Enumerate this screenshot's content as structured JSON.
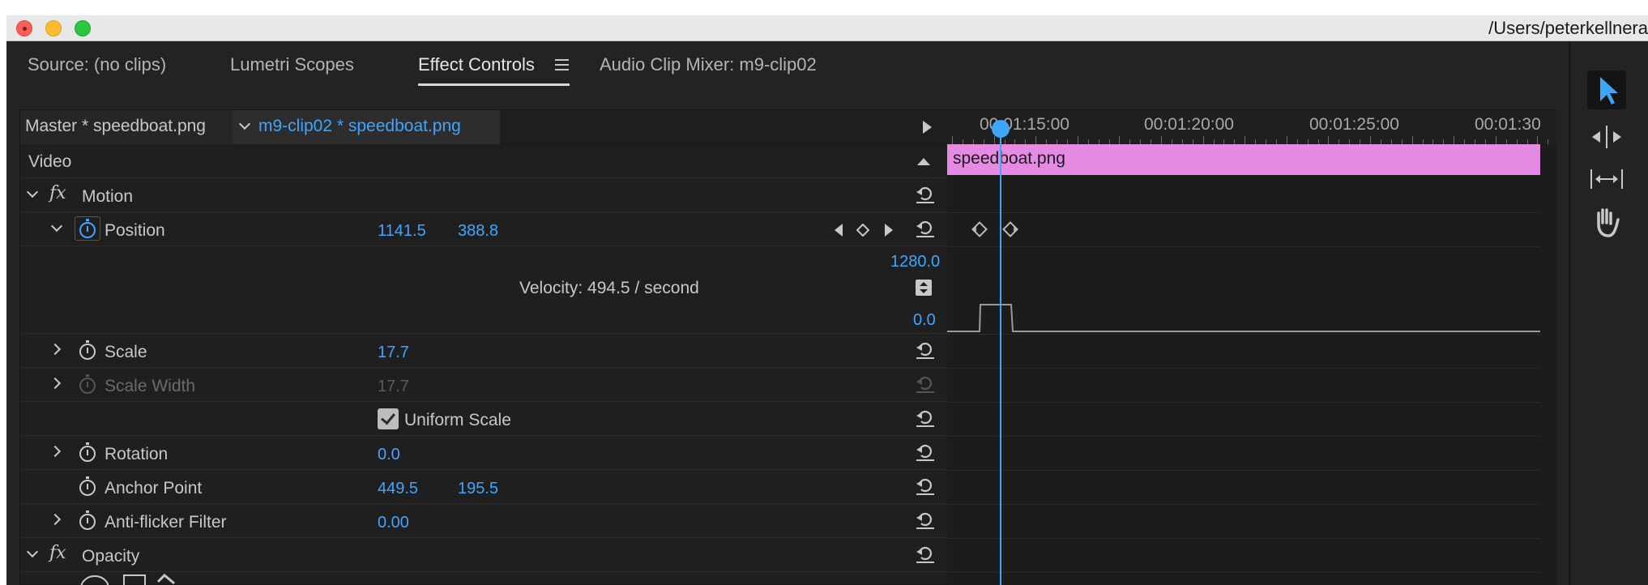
{
  "window": {
    "title_path": "/Users/peterkellnera"
  },
  "tabs": [
    {
      "label": "Source: (no clips)"
    },
    {
      "label": "Lumetri Scopes"
    },
    {
      "label": "Effect Controls"
    },
    {
      "label": "Audio Clip Mixer: m9-clip02"
    }
  ],
  "effect_controls": {
    "master_label": "Master * speedboat.png",
    "clip_label": "m9-clip02 * speedboat.png",
    "section_video": "Video",
    "motion": {
      "label": "Motion",
      "position": {
        "label": "Position",
        "x": "1141.5",
        "y": "388.8"
      },
      "graph": {
        "max": "1280.0",
        "velocity": "Velocity: 494.5 / second",
        "min": "0.0"
      },
      "scale": {
        "label": "Scale",
        "value": "17.7"
      },
      "scale_width": {
        "label": "Scale Width",
        "value": "17.7"
      },
      "uniform_scale": {
        "label": "Uniform Scale",
        "checked": true
      },
      "rotation": {
        "label": "Rotation",
        "value": "0.0"
      },
      "anchor_point": {
        "label": "Anchor Point",
        "x": "449.5",
        "y": "195.5"
      },
      "anti_flicker": {
        "label": "Anti-flicker Filter",
        "value": "0.00"
      }
    },
    "opacity": {
      "label": "Opacity"
    }
  },
  "timeline": {
    "ruler_labels": [
      "00:01:15:00",
      "00:01:20:00",
      "00:01:25:00",
      "00:01:30"
    ],
    "clip_name": "speedboat.png"
  },
  "colors": {
    "accent_blue": "#3ea6ff",
    "clip_pink": "#e58be3",
    "panel_bg": "#232323"
  },
  "icons": [
    "selection-tool-icon",
    "ripple-edit-icon",
    "slip-tool-icon",
    "hand-tool-icon",
    "stopwatch-icon",
    "reset-icon",
    "fx-icon"
  ]
}
